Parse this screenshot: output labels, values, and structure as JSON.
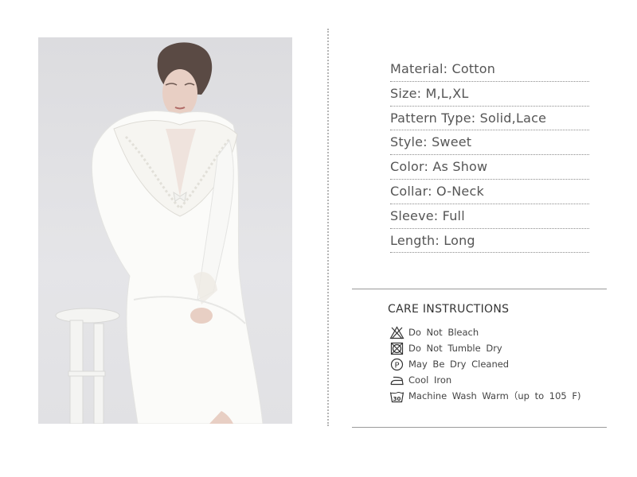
{
  "specs": [
    "Material: Cotton",
    "Size: M,L,XL",
    "Pattern Type: Solid,Lace",
    "Style: Sweet",
    "Color: As Show",
    "Collar: O-Neck",
    "Sleeve: Full",
    "Length: Long"
  ],
  "care": {
    "title": "CARE  INSTRUCTIONS",
    "items": [
      {
        "icon": "no-bleach-icon",
        "label": "Do Not Bleach"
      },
      {
        "icon": "no-tumble-dry-icon",
        "label": "Do Not Tumble Dry"
      },
      {
        "icon": "dry-clean-p-icon",
        "label": "May Be Dry Cleaned"
      },
      {
        "icon": "cool-iron-icon",
        "label": "Cool Iron"
      },
      {
        "icon": "wash-30-icon",
        "label": "Machine Wash Warm（up to 105 F)",
        "icon_text": "30"
      }
    ]
  },
  "colors": {
    "photo_background": "#e1e1e4",
    "garment": "#fbfbf9",
    "text": "#555555",
    "divider": "#9a9a9a"
  }
}
